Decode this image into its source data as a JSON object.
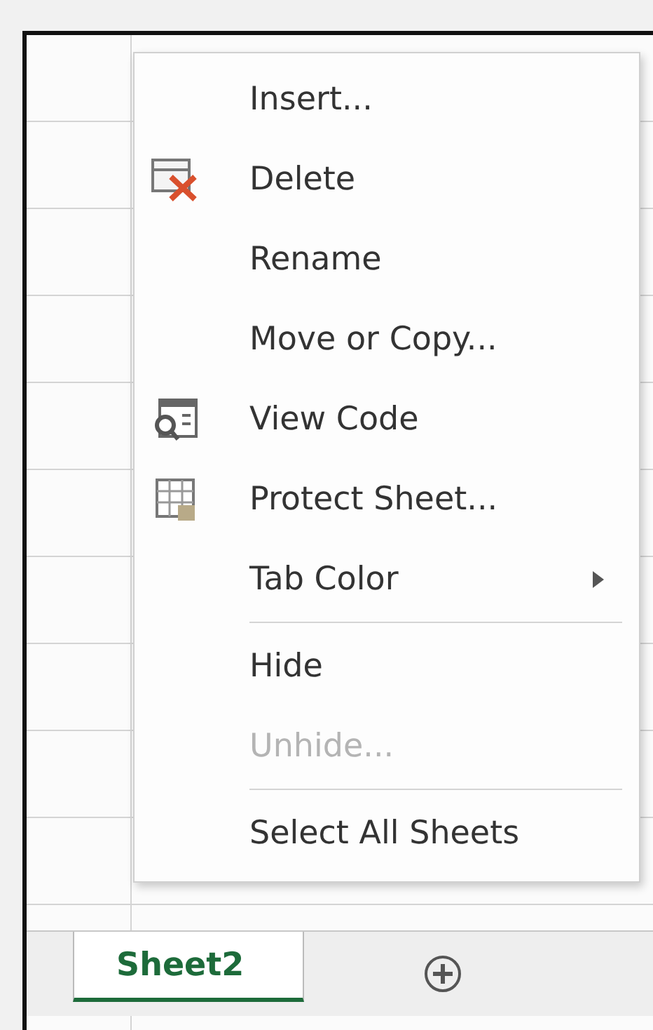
{
  "context_menu": {
    "items": [
      {
        "kind": "plain",
        "label": "Insert...",
        "disabled": false
      },
      {
        "kind": "delete",
        "label": "Delete",
        "disabled": false
      },
      {
        "kind": "plain",
        "label": "Rename",
        "disabled": false
      },
      {
        "kind": "plain",
        "label": "Move or Copy...",
        "disabled": false
      },
      {
        "kind": "view_code",
        "label": "View Code",
        "disabled": false
      },
      {
        "kind": "protect",
        "label": "Protect Sheet...",
        "disabled": false
      },
      {
        "kind": "submenu",
        "label": "Tab Color",
        "disabled": false
      },
      {
        "kind": "separator"
      },
      {
        "kind": "plain",
        "label": "Hide",
        "disabled": false
      },
      {
        "kind": "plain",
        "label": "Unhide...",
        "disabled": true
      },
      {
        "kind": "separator"
      },
      {
        "kind": "plain",
        "label": "Select All Sheets",
        "disabled": false
      }
    ]
  },
  "sheet_tabs": [
    {
      "label": "Sheet2",
      "selected": true
    }
  ]
}
